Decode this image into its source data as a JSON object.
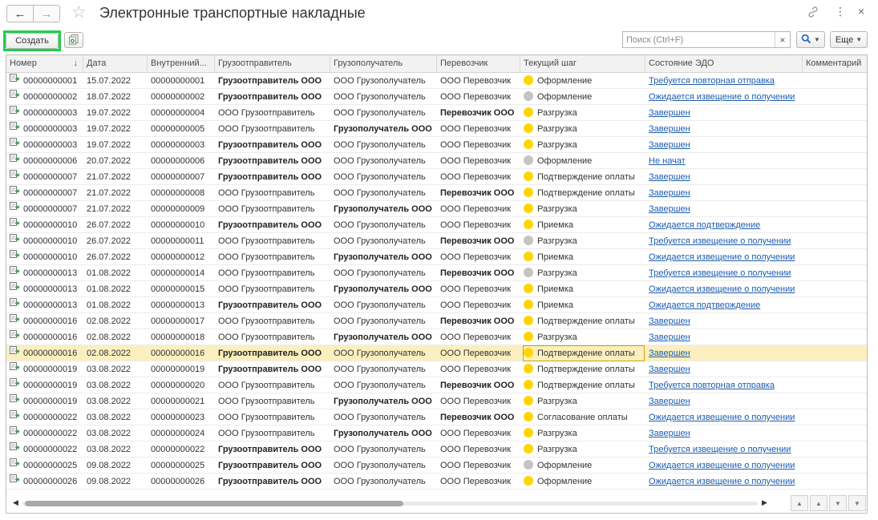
{
  "window": {
    "title": "Электронные транспортные накладные"
  },
  "toolbar": {
    "create_label": "Создать",
    "search_placeholder": "Поиск (Ctrl+F)",
    "clear_glyph": "×",
    "more_label": "Еще"
  },
  "icons": {
    "back": "arrow-left-icon",
    "forward": "arrow-right-icon",
    "favorite": "star-icon",
    "link": "link-icon",
    "menu": "kebab-menu-icon",
    "close": "close-icon",
    "copy": "copy-document-icon",
    "search": "magnifier-icon",
    "row": "document-sent-icon"
  },
  "colors": {
    "status_yellow": "#ffd500",
    "status_gray": "#c4c4c4",
    "link": "#1d5cad",
    "selected_row": "#fbefbf",
    "create_highlight": "#1fd04a"
  },
  "table": {
    "columns": [
      {
        "key": "number",
        "label": "Номер",
        "sorted": "↓"
      },
      {
        "key": "date",
        "label": "Дата"
      },
      {
        "key": "internal",
        "label": "Внутренний..."
      },
      {
        "key": "shipper",
        "label": "Грузоотправитель"
      },
      {
        "key": "consignee",
        "label": "Грузополучатель"
      },
      {
        "key": "carrier",
        "label": "Перевозчик"
      },
      {
        "key": "step",
        "label": "Текущий шаг"
      },
      {
        "key": "edo",
        "label": "Состояние ЭДО"
      },
      {
        "key": "comment",
        "label": "Комментарий"
      }
    ],
    "selected_row": 17,
    "rows": [
      {
        "number": "00000000001",
        "date": "15.07.2022",
        "internal": "00000000001",
        "shipper": "Грузоотправитель ООО",
        "consignee": "ООО Грузополучатель",
        "carrier": "ООО Перевозчик",
        "step": "Оформление",
        "status": "yellow",
        "edo": "Требуется повторная отправка",
        "bold": "shipper"
      },
      {
        "number": "00000000002",
        "date": "18.07.2022",
        "internal": "00000000002",
        "shipper": "Грузоотправитель ООО",
        "consignee": "ООО Грузополучатель",
        "carrier": "ООО Перевозчик",
        "step": "Оформление",
        "status": "gray",
        "edo": "Ожидается извещение о получении",
        "bold": "shipper"
      },
      {
        "number": "00000000003",
        "date": "19.07.2022",
        "internal": "00000000004",
        "shipper": "ООО Грузоотправитель",
        "consignee": "ООО Грузополучатель",
        "carrier": "Перевозчик ООО",
        "step": "Разгрузка",
        "status": "yellow",
        "edo": "Завершен",
        "bold": "carrier"
      },
      {
        "number": "00000000003",
        "date": "19.07.2022",
        "internal": "00000000005",
        "shipper": "ООО Грузоотправитель",
        "consignee": "Грузополучатель ООО",
        "carrier": "ООО Перевозчик",
        "step": "Разгрузка",
        "status": "yellow",
        "edo": "Завершен",
        "bold": "consignee"
      },
      {
        "number": "00000000003",
        "date": "19.07.2022",
        "internal": "00000000003",
        "shipper": "Грузоотправитель ООО",
        "consignee": "ООО Грузополучатель",
        "carrier": "ООО Перевозчик",
        "step": "Разгрузка",
        "status": "yellow",
        "edo": "Завершен",
        "bold": "shipper"
      },
      {
        "number": "00000000006",
        "date": "20.07.2022",
        "internal": "00000000006",
        "shipper": "Грузоотправитель ООО",
        "consignee": "ООО Грузополучатель",
        "carrier": "ООО Перевозчик",
        "step": "Оформление",
        "status": "gray",
        "edo": "Не начат",
        "bold": "shipper"
      },
      {
        "number": "00000000007",
        "date": "21.07.2022",
        "internal": "00000000007",
        "shipper": "Грузоотправитель ООО",
        "consignee": "ООО Грузополучатель",
        "carrier": "ООО Перевозчик",
        "step": "Подтверждение оплаты",
        "status": "yellow",
        "edo": "Завершен",
        "bold": "shipper"
      },
      {
        "number": "00000000007",
        "date": "21.07.2022",
        "internal": "00000000008",
        "shipper": "ООО Грузоотправитель",
        "consignee": "ООО Грузополучатель",
        "carrier": "Перевозчик ООО",
        "step": "Подтверждение оплаты",
        "status": "yellow",
        "edo": "Завершен",
        "bold": "carrier"
      },
      {
        "number": "00000000007",
        "date": "21.07.2022",
        "internal": "00000000009",
        "shipper": "ООО Грузоотправитель",
        "consignee": "Грузополучатель ООО",
        "carrier": "ООО Перевозчик",
        "step": "Разгрузка",
        "status": "yellow",
        "edo": "Завершен",
        "bold": "consignee"
      },
      {
        "number": "00000000010",
        "date": "26.07.2022",
        "internal": "00000000010",
        "shipper": "Грузоотправитель ООО",
        "consignee": "ООО Грузополучатель",
        "carrier": "ООО Перевозчик",
        "step": "Приемка",
        "status": "yellow",
        "edo": "Ожидается подтверждение",
        "bold": "shipper"
      },
      {
        "number": "00000000010",
        "date": "26.07.2022",
        "internal": "00000000011",
        "shipper": "ООО Грузоотправитель",
        "consignee": "ООО Грузополучатель",
        "carrier": "Перевозчик ООО",
        "step": "Разгрузка",
        "status": "gray",
        "edo": "Требуется извещение о получении",
        "bold": "carrier"
      },
      {
        "number": "00000000010",
        "date": "26.07.2022",
        "internal": "00000000012",
        "shipper": "ООО Грузоотправитель",
        "consignee": "Грузополучатель ООО",
        "carrier": "ООО Перевозчик",
        "step": "Приемка",
        "status": "yellow",
        "edo": "Ожидается извещение о получении",
        "bold": "consignee"
      },
      {
        "number": "00000000013",
        "date": "01.08.2022",
        "internal": "00000000014",
        "shipper": "ООО Грузоотправитель",
        "consignee": "ООО Грузополучатель",
        "carrier": "Перевозчик ООО",
        "step": "Разгрузка",
        "status": "gray",
        "edo": "Требуется извещение о получении",
        "bold": "carrier"
      },
      {
        "number": "00000000013",
        "date": "01.08.2022",
        "internal": "00000000015",
        "shipper": "ООО Грузоотправитель",
        "consignee": "Грузополучатель ООО",
        "carrier": "ООО Перевозчик",
        "step": "Приемка",
        "status": "yellow",
        "edo": "Ожидается извещение о получении",
        "bold": "consignee"
      },
      {
        "number": "00000000013",
        "date": "01.08.2022",
        "internal": "00000000013",
        "shipper": "Грузоотправитель ООО",
        "consignee": "ООО Грузополучатель",
        "carrier": "ООО Перевозчик",
        "step": "Приемка",
        "status": "yellow",
        "edo": "Ожидается подтверждение",
        "bold": "shipper"
      },
      {
        "number": "00000000016",
        "date": "02.08.2022",
        "internal": "00000000017",
        "shipper": "ООО Грузоотправитель",
        "consignee": "ООО Грузополучатель",
        "carrier": "Перевозчик ООО",
        "step": "Подтверждение оплаты",
        "status": "yellow",
        "edo": "Завершен",
        "bold": "carrier"
      },
      {
        "number": "00000000016",
        "date": "02.08.2022",
        "internal": "00000000018",
        "shipper": "ООО Грузоотправитель",
        "consignee": "Грузополучатель ООО",
        "carrier": "ООО Перевозчик",
        "step": "Разгрузка",
        "status": "yellow",
        "edo": "Завершен",
        "bold": "consignee"
      },
      {
        "number": "00000000016",
        "date": "02.08.2022",
        "internal": "00000000016",
        "shipper": "Грузоотправитель ООО",
        "consignee": "ООО Грузополучатель",
        "carrier": "ООО Перевозчик",
        "step": "Подтверждение оплаты",
        "status": "yellow",
        "edo": "Завершен",
        "bold": "shipper"
      },
      {
        "number": "00000000019",
        "date": "03.08.2022",
        "internal": "00000000019",
        "shipper": "Грузоотправитель ООО",
        "consignee": "ООО Грузополучатель",
        "carrier": "ООО Перевозчик",
        "step": "Подтверждение оплаты",
        "status": "yellow",
        "edo": "Завершен",
        "bold": "shipper"
      },
      {
        "number": "00000000019",
        "date": "03.08.2022",
        "internal": "00000000020",
        "shipper": "ООО Грузоотправитель",
        "consignee": "ООО Грузополучатель",
        "carrier": "Перевозчик ООО",
        "step": "Подтверждение оплаты",
        "status": "yellow",
        "edo": "Требуется повторная отправка",
        "bold": "carrier"
      },
      {
        "number": "00000000019",
        "date": "03.08.2022",
        "internal": "00000000021",
        "shipper": "ООО Грузоотправитель",
        "consignee": "Грузополучатель ООО",
        "carrier": "ООО Перевозчик",
        "step": "Разгрузка",
        "status": "yellow",
        "edo": "Завершен",
        "bold": "consignee"
      },
      {
        "number": "00000000022",
        "date": "03.08.2022",
        "internal": "00000000023",
        "shipper": "ООО Грузоотправитель",
        "consignee": "ООО Грузополучатель",
        "carrier": "Перевозчик ООО",
        "step": "Согласование оплаты",
        "status": "yellow",
        "edo": "Ожидается извещение о получении",
        "bold": "carrier"
      },
      {
        "number": "00000000022",
        "date": "03.08.2022",
        "internal": "00000000024",
        "shipper": "ООО Грузоотправитель",
        "consignee": "Грузополучатель ООО",
        "carrier": "ООО Перевозчик",
        "step": "Разгрузка",
        "status": "yellow",
        "edo": "Завершен",
        "bold": "consignee"
      },
      {
        "number": "00000000022",
        "date": "03.08.2022",
        "internal": "00000000022",
        "shipper": "Грузоотправитель ООО",
        "consignee": "ООО Грузополучатель",
        "carrier": "ООО Перевозчик",
        "step": "Разгрузка",
        "status": "yellow",
        "edo": "Требуется извещение о получении",
        "bold": "shipper"
      },
      {
        "number": "00000000025",
        "date": "09.08.2022",
        "internal": "00000000025",
        "shipper": "Грузоотправитель ООО",
        "consignee": "ООО Грузополучатель",
        "carrier": "ООО Перевозчик",
        "step": "Оформление",
        "status": "gray",
        "edo": "Ожидается извещение о получении",
        "bold": "shipper"
      },
      {
        "number": "00000000026",
        "date": "09.08.2022",
        "internal": "00000000026",
        "shipper": "Грузоотправитель ООО",
        "consignee": "ООО Грузополучатель",
        "carrier": "ООО Перевозчик",
        "step": "Оформление",
        "status": "yellow",
        "edo": "Ожидается извещение о получении",
        "bold": "shipper"
      }
    ]
  }
}
